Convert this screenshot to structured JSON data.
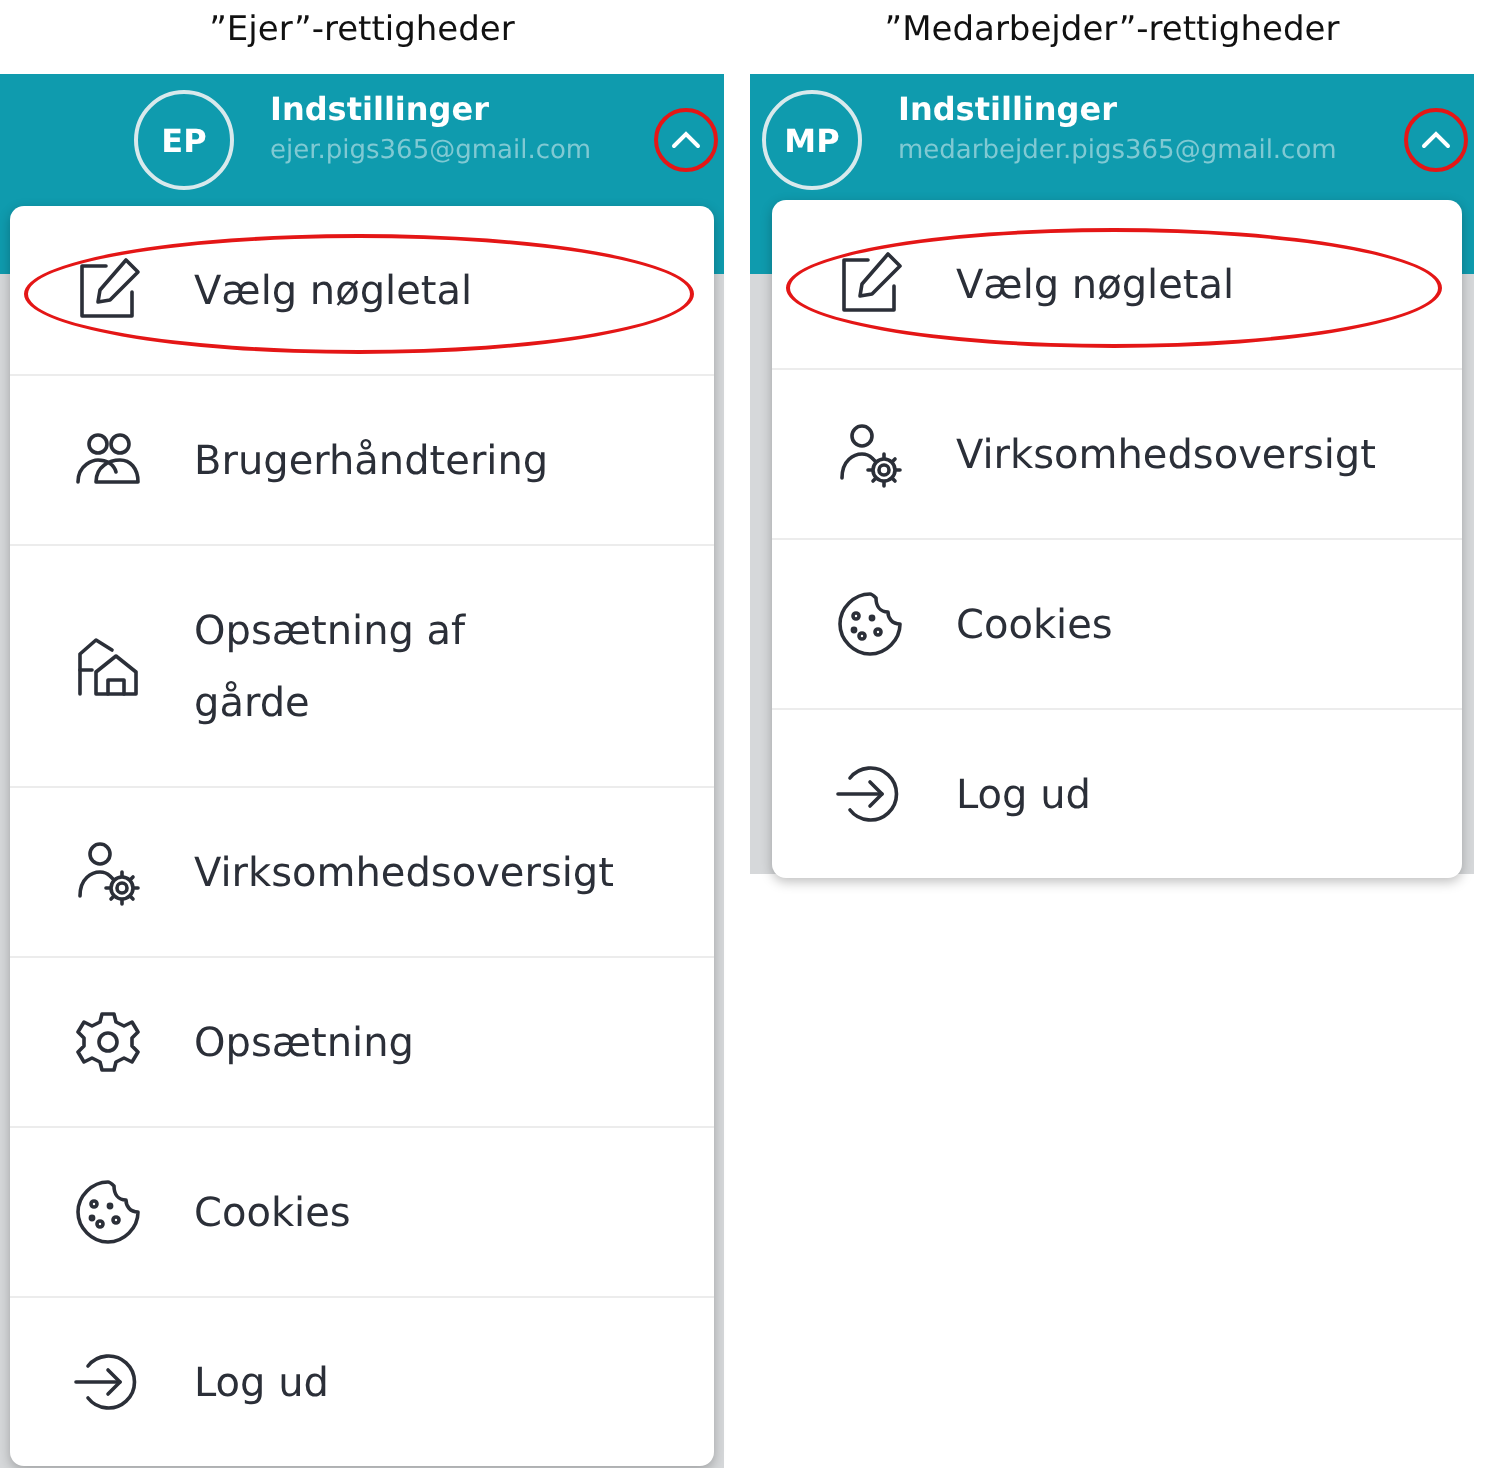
{
  "panels": [
    {
      "caption": "”Ejer”-rettigheder",
      "header": {
        "initials": "EP",
        "title": "Indstillinger",
        "email": "ejer.pigs365@gmail.com",
        "chevron_annotated": true
      },
      "menu": [
        {
          "kind": "edit",
          "label": "Vælg nøgletal",
          "annotated": true
        },
        {
          "kind": "users",
          "label": "Brugerhåndtering",
          "annotated": false
        },
        {
          "kind": "farm",
          "label": "Opsætning af gårde",
          "annotated": false
        },
        {
          "kind": "person-gear",
          "label": "Virksomhedsoversigt",
          "annotated": false
        },
        {
          "kind": "gear",
          "label": "Opsætning",
          "annotated": false
        },
        {
          "kind": "cookie",
          "label": "Cookies",
          "annotated": false
        },
        {
          "kind": "logout",
          "label": "Log ud",
          "annotated": false
        }
      ]
    },
    {
      "caption": "”Medarbejder”-rettigheder",
      "header": {
        "initials": "MP",
        "title": "Indstillinger",
        "email": "medarbejder.pigs365@gmail.com",
        "chevron_annotated": true
      },
      "menu": [
        {
          "kind": "edit",
          "label": "Vælg nøgletal",
          "annotated": true
        },
        {
          "kind": "person-gear",
          "label": "Virksomhedsoversigt",
          "annotated": false
        },
        {
          "kind": "cookie",
          "label": "Cookies",
          "annotated": false
        },
        {
          "kind": "logout",
          "label": "Log ud",
          "annotated": false
        }
      ]
    }
  ]
}
